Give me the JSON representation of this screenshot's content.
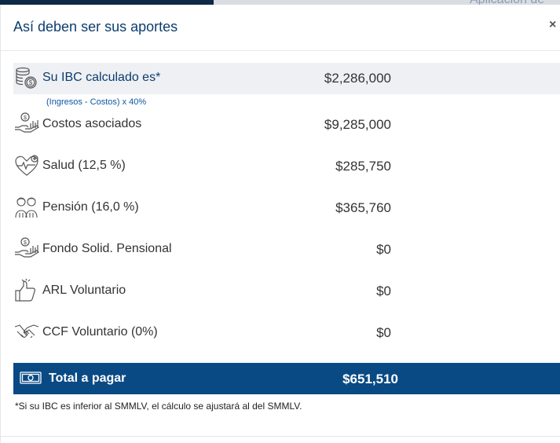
{
  "background": {
    "partial_text": "Aplicación de"
  },
  "modal": {
    "title": "Así deben ser sus aportes",
    "close": "×"
  },
  "ibc": {
    "label": "Su IBC calculado es*",
    "amount": "$2,286,000",
    "formula": "(Ingresos - Costos) x 40%",
    "icon": "coins-icon"
  },
  "rows": [
    {
      "label": "Costos asociados",
      "amount": "$9,285,000",
      "icon": "money-hand-icon"
    },
    {
      "label": "Salud (12,5 %)",
      "amount": "$285,750",
      "icon": "heart-pulse-icon"
    },
    {
      "label": "Pensión (16,0 %)",
      "amount": "$365,760",
      "icon": "elderly-couple-icon"
    },
    {
      "label": "Fondo Solid. Pensional",
      "amount": "$0",
      "icon": "money-hand-icon"
    },
    {
      "label": "ARL Voluntario",
      "amount": "$0",
      "icon": "thumbs-up-icon"
    },
    {
      "label": "CCF Voluntario (0%)",
      "amount": "$0",
      "icon": "handshake-icon"
    }
  ],
  "total": {
    "label": "Total a pagar",
    "amount": "$651,510",
    "icon": "banknote-icon"
  },
  "note": "*Si su IBC es inferior al SMMLV, el cálculo se ajustará al del SMMLV.",
  "colors": {
    "primary": "#0a4a84",
    "title": "#0c3d6e",
    "link": "#0c56a3",
    "row_highlight": "#eef0f3"
  }
}
